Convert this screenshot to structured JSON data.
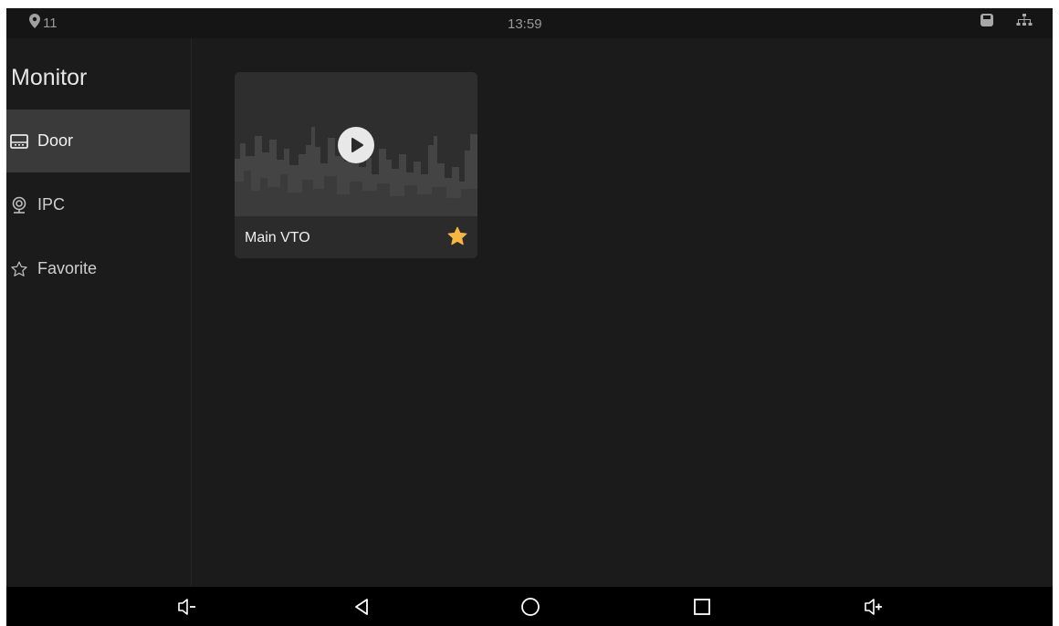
{
  "status_bar": {
    "location_count": "11",
    "clock": "13:59",
    "icons": [
      "location-pin-icon",
      "sd-card-icon",
      "network-icon"
    ]
  },
  "sidebar": {
    "title": "Monitor",
    "items": [
      {
        "label": "Door",
        "icon": "door-station-icon",
        "active": true
      },
      {
        "label": "IPC",
        "icon": "camera-icon",
        "active": false
      },
      {
        "label": "Favorite",
        "icon": "star-outline-icon",
        "active": false
      }
    ]
  },
  "devices": [
    {
      "name": "Main VTO",
      "favorite": true,
      "icon": "play-icon"
    }
  ],
  "navbar": {
    "buttons": [
      "volume-down-icon",
      "back-icon",
      "home-icon",
      "recents-icon",
      "volume-up-icon"
    ]
  },
  "colors": {
    "background": "#1b1b1b",
    "active_item": "#3a3a3a",
    "star": "#f5b642",
    "text": "#e6e6e6"
  }
}
